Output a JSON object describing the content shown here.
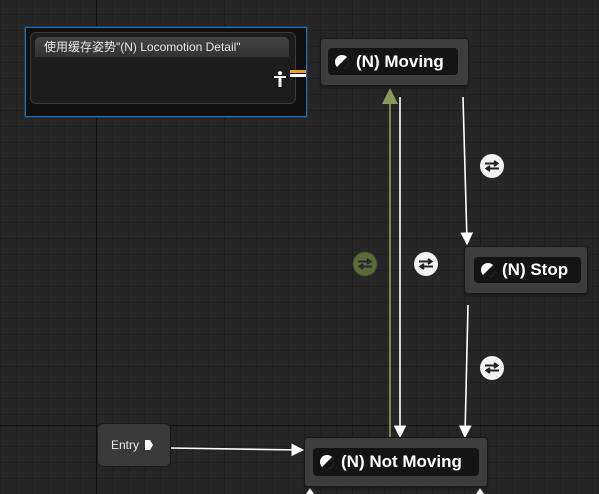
{
  "cached_pose_node": {
    "title": "使用缓存姿势\"(N) Locomotion Detail\"",
    "output_icon": "person-icon"
  },
  "states": {
    "moving": "(N) Moving",
    "stop": "(N) Stop",
    "not_moving": "(N) Not Moving",
    "icon": "state-half-circle-icon"
  },
  "entry": {
    "label": "Entry",
    "icon": "entry-arrow-icon"
  },
  "transition_icon": "transition-arrows-icon",
  "colors": {
    "background": "#262626",
    "selection_border": "#2a6aa8",
    "pose_pin": "#e9a12a",
    "transition_inactive": "#5b6b3b",
    "wire": "#ffffff"
  }
}
